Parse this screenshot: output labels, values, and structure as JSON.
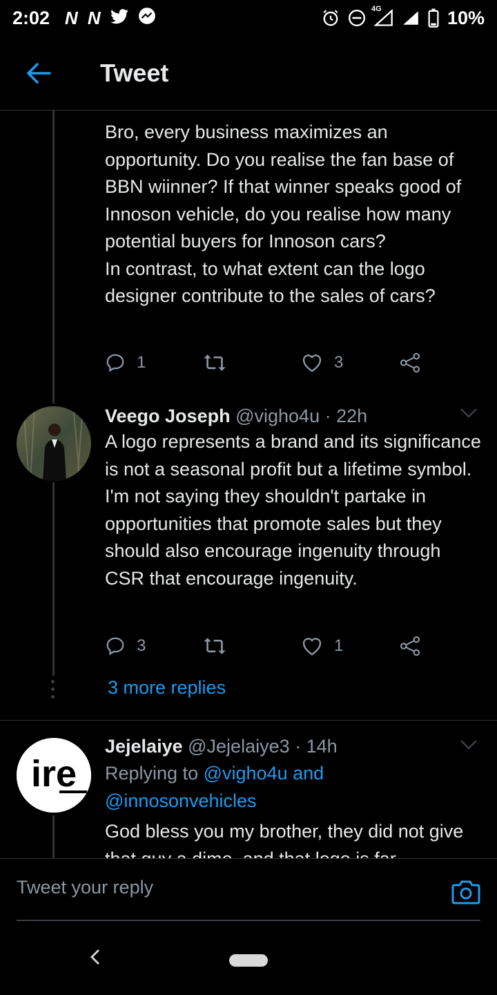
{
  "status_bar": {
    "time": "2:02",
    "battery": "10%",
    "network": "4G",
    "icons": [
      "n-notification-icon",
      "n-notification-icon",
      "twitter-icon",
      "messenger-icon",
      "alarm-icon",
      "dnd-icon",
      "signal-icon",
      "signal-icon",
      "battery-icon"
    ]
  },
  "header": {
    "title": "Tweet"
  },
  "tweets": [
    {
      "text": "Bro, every business maximizes an opportunity. Do you realise the fan base of BBN wiinner? If that winner speaks good of Innoson vehicle, do you realise how many potential buyers for Innoson cars?\nIn contrast, to what extent can the logo designer contribute to the sales of cars?",
      "replies": "1",
      "retweets": "",
      "likes": "3"
    },
    {
      "name": "Veego Joseph",
      "handle": "@vigho4u · 22h",
      "text": "A logo represents a brand and its significance is not a seasonal profit but a lifetime symbol. I'm not saying they shouldn't partake in opportunities that promote sales but they should also encourage ingenuity through CSR that encourage ingenuity.",
      "replies": "3",
      "retweets": "",
      "likes": "1",
      "more_replies": "3 more replies"
    },
    {
      "name": "Jejelaiye",
      "handle": "@Jejelaiye3 · 14h",
      "replying_prefix": "Replying to",
      "replying_to_1": "@vigho4u and",
      "replying_to_2": "@innosonvehicles",
      "avatar_text": "ire",
      "text": "God bless you my brother, they did not give that guy a dime, and that logo is far"
    }
  ],
  "reply_bar": {
    "placeholder": "Tweet your reply"
  },
  "colors": {
    "accent": "#1d9bf0",
    "muted": "#8b98a5",
    "background": "#000000"
  }
}
